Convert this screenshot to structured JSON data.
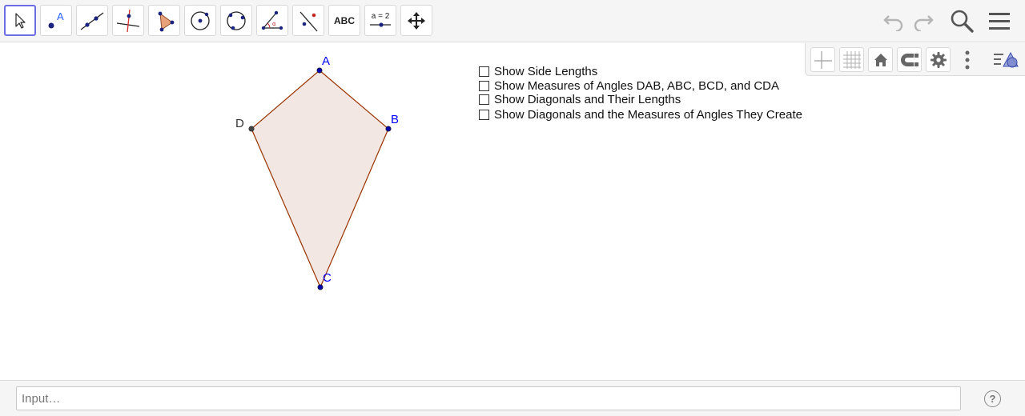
{
  "toolbar": {
    "tools": [
      {
        "icon": "move-arrow-icon",
        "active": true
      },
      {
        "icon": "point-icon"
      },
      {
        "icon": "line-icon"
      },
      {
        "icon": "perpendicular-line-icon"
      },
      {
        "icon": "polygon-icon"
      },
      {
        "icon": "circle-center-point-icon"
      },
      {
        "icon": "circle-three-points-icon"
      },
      {
        "icon": "angle-icon"
      },
      {
        "icon": "reflect-about-line-icon"
      },
      {
        "icon": "text-icon",
        "label": "ABC"
      },
      {
        "icon": "slider-icon",
        "label": "a = 2"
      },
      {
        "icon": "move-graphics-view-icon"
      }
    ],
    "right": [
      "undo-icon",
      "redo-icon",
      "search-icon",
      "menu-icon"
    ]
  },
  "stylebar": {
    "buttons": [
      "axes-icon",
      "grid-icon",
      "standard-view-icon",
      "point-capturing-icon",
      "settings-icon",
      "more-icon",
      "algebra-view-icon"
    ]
  },
  "figure": {
    "points": [
      {
        "label": "A",
        "color": "#0000ff"
      },
      {
        "label": "B",
        "color": "#0000ff"
      },
      {
        "label": "C",
        "color": "#0000ff"
      },
      {
        "label": "D",
        "color": "#333333"
      }
    ],
    "fill_color": "#f3e7e4",
    "edge_color": "#993300"
  },
  "checkboxes": [
    {
      "label": "Show Side Lengths",
      "checked": false
    },
    {
      "label": "Show Measures of Angles DAB, ABC, BCD, and CDA",
      "checked": false
    },
    {
      "label": "Show Diagonals and Their Lengths",
      "checked": false
    },
    {
      "label": "Show Diagonals and the Measures of Angles They Create",
      "checked": false
    }
  ],
  "inputbar": {
    "placeholder": "Input…",
    "value": "",
    "help": "?"
  },
  "colors": {
    "accent": "#6c6ce4",
    "toolbar_bg": "#f5f5f5"
  }
}
